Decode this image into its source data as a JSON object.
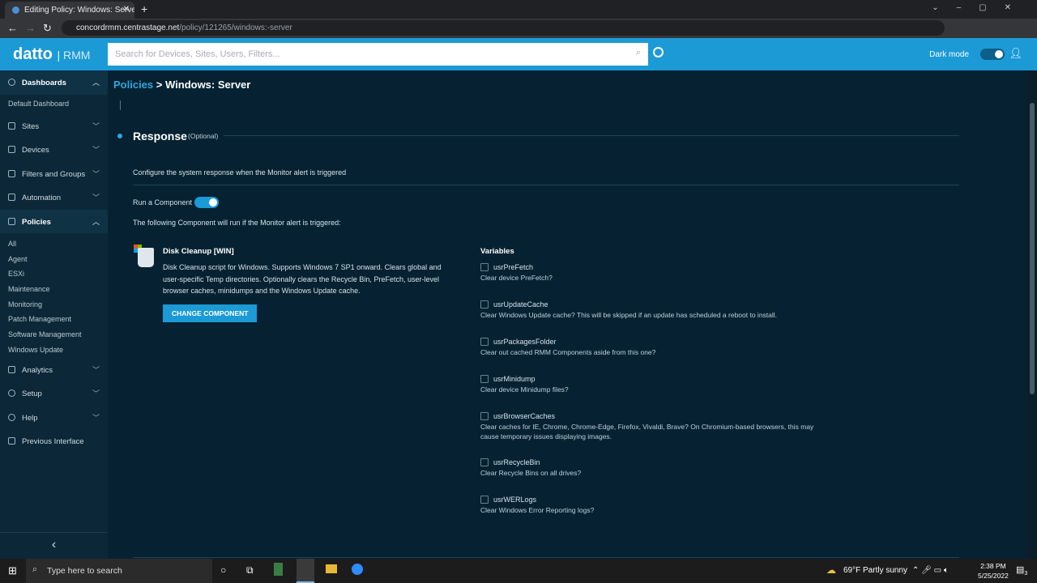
{
  "browser": {
    "tab_title": "Editing Policy: Windows: Server -",
    "url_host": "concordrmm.centrastage.net",
    "url_path": "/policy/121265/windows:-server"
  },
  "app": {
    "logo": "datto",
    "logo_product": "RMM",
    "search_placeholder": "Search for Devices, Sites, Users, Filters...",
    "dark_mode_label": "Dark mode"
  },
  "sidebar": {
    "dashboards": "Dashboards",
    "default_dashboard": "Default Dashboard",
    "sites": "Sites",
    "devices": "Devices",
    "filters": "Filters and Groups",
    "automation": "Automation",
    "policies": "Policies",
    "policy_items": [
      "All",
      "Agent",
      "ESXi",
      "Maintenance",
      "Monitoring",
      "Patch Management",
      "Software Management",
      "Windows Update"
    ],
    "analytics": "Analytics",
    "setup": "Setup",
    "help": "Help",
    "previous": "Previous Interface"
  },
  "breadcrumb": {
    "parent": "Policies",
    "separator": ">",
    "current": "Windows: Server"
  },
  "response": {
    "title": "Response",
    "optional": "(Optional)",
    "description": "Configure the system response when the Monitor alert is triggered",
    "run_component_label": "Run a Component",
    "run_component_on": true,
    "following_text": "The following Component will run if the Monitor alert is triggered:"
  },
  "component": {
    "name": "Disk Cleanup [WIN]",
    "description": "Disk Cleanup script for Windows. Supports Windows 7 SP1 onward. Clears global and user-specific Temp directories. Optionally clears the Recycle Bin, PreFetch, user-level browser caches, minidumps and the Windows Update cache.",
    "change_button": "CHANGE COMPONENT"
  },
  "variables": {
    "title": "Variables",
    "items": [
      {
        "name": "usrPreFetch",
        "desc": "Clear device PreFetch?"
      },
      {
        "name": "usrUpdateCache",
        "desc": "Clear Windows Update cache? This will be skipped if an update has scheduled a reboot to install."
      },
      {
        "name": "usrPackagesFolder",
        "desc": "Clear out cached RMM Components aside from this one?"
      },
      {
        "name": "usrMinidump",
        "desc": "Clear device Minidump files?"
      },
      {
        "name": "usrBrowserCaches",
        "desc": "Clear caches for IE, Chrome, Chrome-Edge, Firefox, Vivaldi, Brave? On Chromium-based browsers, this may cause temporary issues displaying images."
      },
      {
        "name": "usrRecycleBin",
        "desc": "Clear Recycle Bins on all drives?"
      },
      {
        "name": "usrWERLogs",
        "desc": "Clear Windows Error Reporting logs?"
      }
    ]
  },
  "taskbar": {
    "search_placeholder": "Type here to search",
    "weather": "69°F  Partly sunny",
    "time": "2:38 PM",
    "date": "5/25/2022",
    "notifications": "3"
  }
}
